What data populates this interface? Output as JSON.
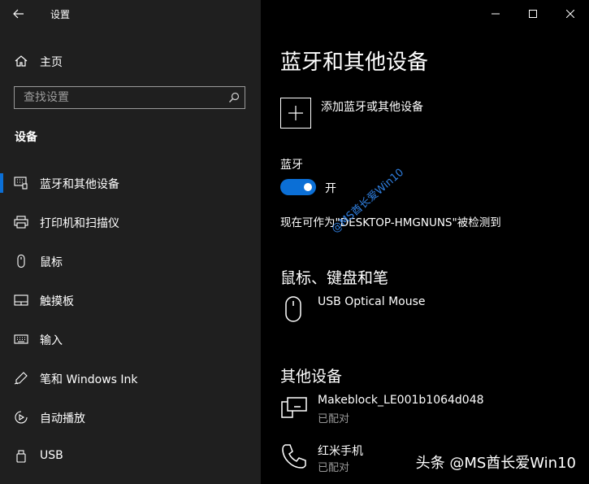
{
  "window": {
    "title": "设置"
  },
  "sidebar": {
    "home_label": "主页",
    "search_placeholder": "查找设置",
    "section_title": "设备",
    "items": [
      {
        "label": "蓝牙和其他设备",
        "icon": "bluetooth-devices-icon",
        "active": true
      },
      {
        "label": "打印机和扫描仪",
        "icon": "printer-icon"
      },
      {
        "label": "鼠标",
        "icon": "mouse-icon"
      },
      {
        "label": "触摸板",
        "icon": "touchpad-icon"
      },
      {
        "label": "输入",
        "icon": "keyboard-icon"
      },
      {
        "label": "笔和 Windows Ink",
        "icon": "pen-icon"
      },
      {
        "label": "自动播放",
        "icon": "autoplay-icon"
      },
      {
        "label": "USB",
        "icon": "usb-icon"
      }
    ]
  },
  "main": {
    "title": "蓝牙和其他设备",
    "add_device_label": "添加蓝牙或其他设备",
    "bluetooth": {
      "label": "蓝牙",
      "state_label": "开",
      "discoverable_text": "现在可作为\"DESKTOP-HMGNUNS\"被检测到"
    },
    "mouse_section": {
      "title": "鼠标、键盘和笔",
      "devices": [
        {
          "name": "USB Optical Mouse"
        }
      ]
    },
    "other_section": {
      "title": "其他设备",
      "devices": [
        {
          "name": "Makeblock_LE001b1064d048",
          "status": "已配对"
        },
        {
          "name": "红米手机",
          "status": "已配对"
        }
      ]
    }
  },
  "watermark": "@MS酋长爱Win10",
  "footer_watermark": "头条 @MS酋长爱Win10",
  "colors": {
    "accent": "#0b6fd6",
    "sidebar_bg": "#1f1f1f",
    "main_bg": "#000000",
    "watermark": "#2f7fe0"
  }
}
